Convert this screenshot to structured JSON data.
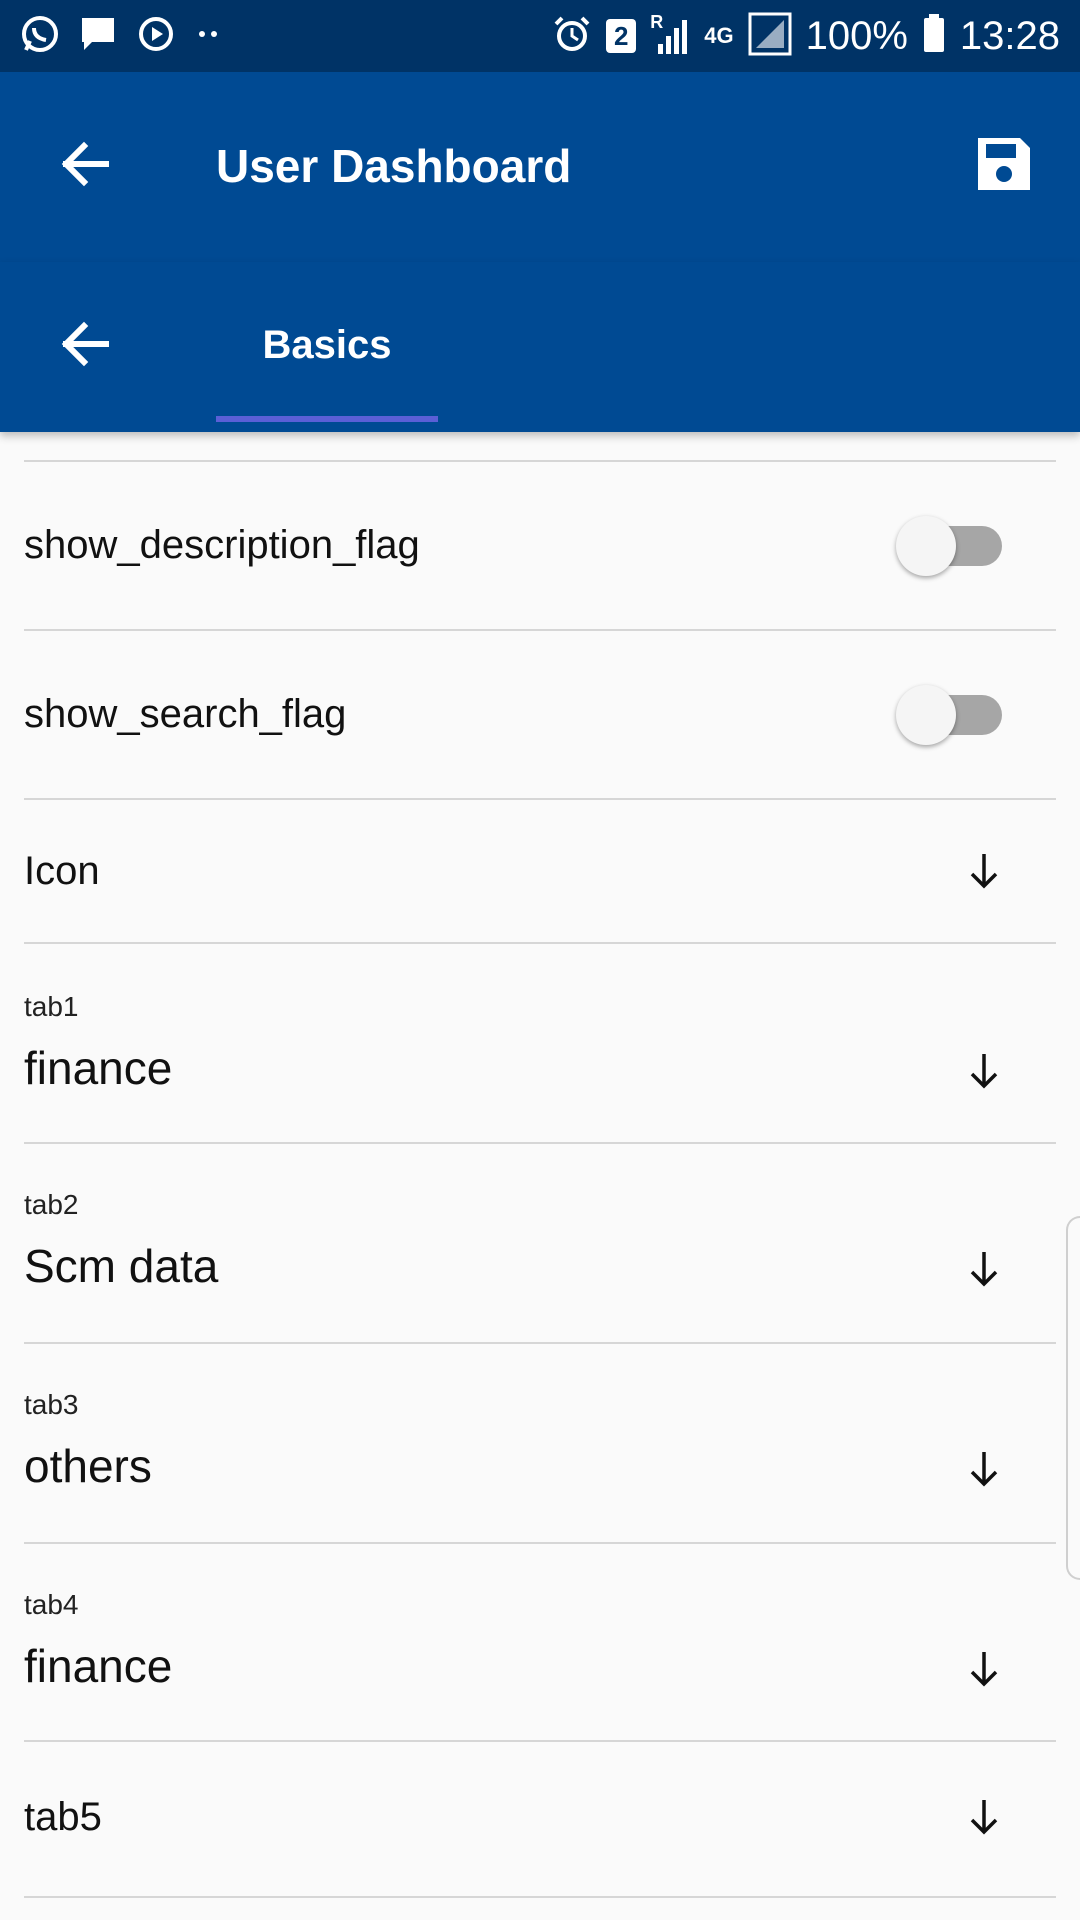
{
  "status_bar": {
    "badge": "2",
    "roaming": "R",
    "network": "4G",
    "battery": "100%",
    "time": "13:28"
  },
  "app_bar": {
    "title": "User Dashboard",
    "back_icon": "arrow-left-icon",
    "save_icon": "save-icon"
  },
  "tab_bar": {
    "back_icon": "arrow-left-icon",
    "tabs": [
      {
        "label": "Basics",
        "selected": true
      }
    ]
  },
  "settings": {
    "toggles": [
      {
        "label": "show_description_flag",
        "on": false
      },
      {
        "label": "show_search_flag",
        "on": false
      }
    ],
    "selects": [
      {
        "label": "Icon",
        "value": ""
      },
      {
        "label": "tab1",
        "value": "finance"
      },
      {
        "label": "tab2",
        "value": "Scm data"
      },
      {
        "label": "tab3",
        "value": "others"
      },
      {
        "label": "tab4",
        "value": "finance"
      },
      {
        "label": "tab5",
        "value": ""
      }
    ]
  },
  "colors": {
    "status_bar": "#003366",
    "app_bar": "#004a93",
    "tab_indicator": "#5b5fd6",
    "toggle_track_off": "#a6a6a6"
  }
}
